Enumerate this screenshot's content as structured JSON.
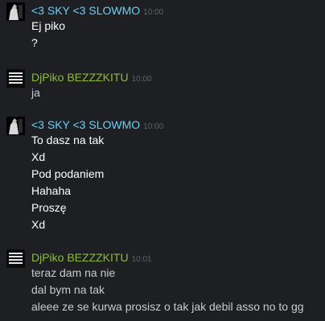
{
  "groups": [
    {
      "sender": "<3 SKY <3 SLOWMO",
      "time": "10:00",
      "avatar": "sky-avatar",
      "name_color": "#6dcff6",
      "messages": [
        "Ej piko",
        "?"
      ]
    },
    {
      "sender": "DjPiko BEZZZKITU",
      "time": "10:00",
      "avatar": "djpiko-avatar",
      "avatar_text": "JAK CI MAMUŚ BĘDZIE SALTO",
      "name_color": "#90ba3c",
      "messages": [
        "ja"
      ]
    },
    {
      "sender": "<3 SKY <3 SLOWMO",
      "time": "10:00",
      "avatar": "sky-avatar",
      "name_color": "#6dcff6",
      "messages": [
        "To dasz na tak",
        "Xd",
        "Pod podaniem",
        "Hahaha",
        "Proszę",
        "Xd"
      ]
    },
    {
      "sender": "DjPiko BEZZZKITU",
      "time": "10:01",
      "avatar": "djpiko-avatar",
      "avatar_text": "JAK CI MAMUŚ BĘDZIE SALTO",
      "name_color": "#90ba3c",
      "messages": [
        "teraz dam na nie",
        "dal bym na tak",
        "aleee ze se kurwa prosisz o tak jak debil asso no to gg"
      ]
    }
  ]
}
